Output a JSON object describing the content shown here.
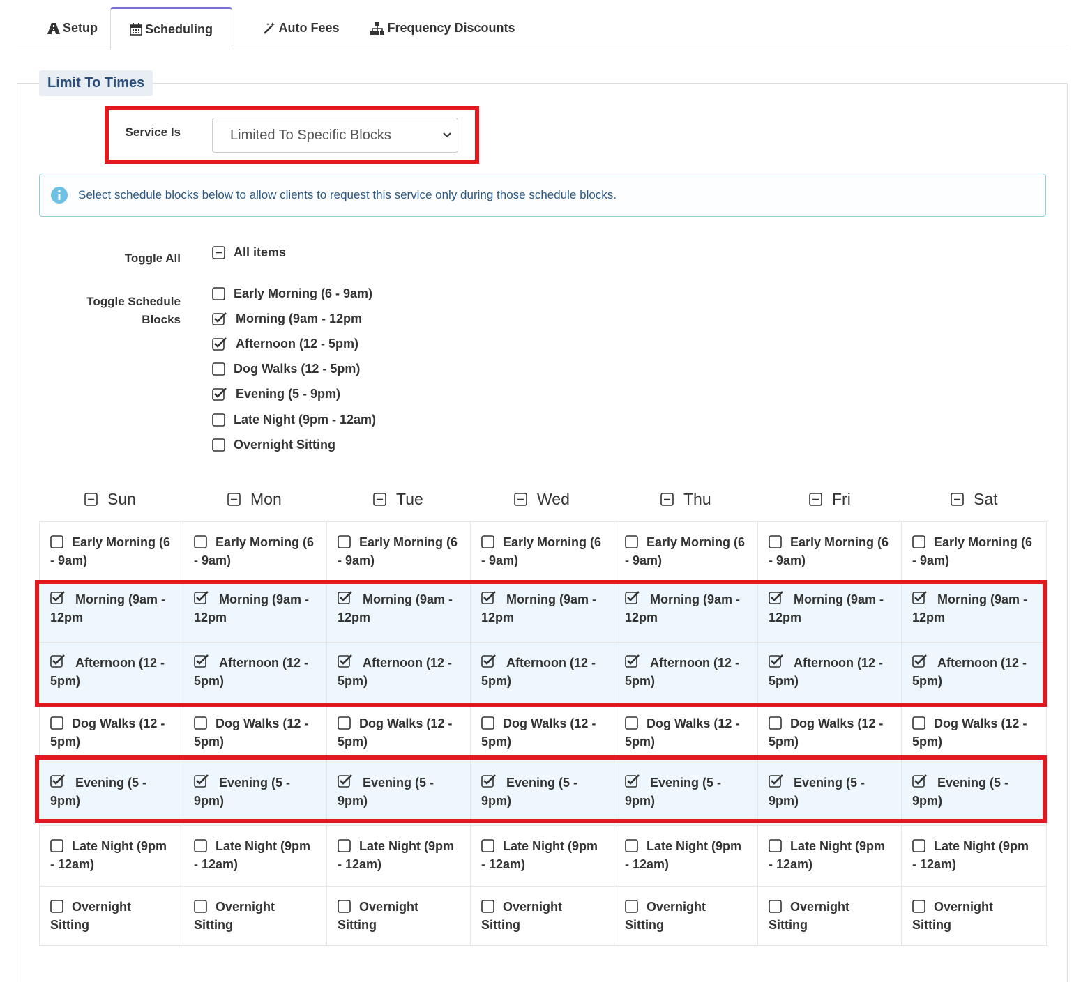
{
  "tabs": [
    {
      "label": "Setup",
      "icon": "road-icon"
    },
    {
      "label": "Scheduling",
      "icon": "calendar-icon",
      "active": true
    },
    {
      "label": "Auto Fees",
      "icon": "magic-wand-icon"
    },
    {
      "label": "Frequency Discounts",
      "icon": "sitemap-icon"
    }
  ],
  "section": {
    "title": "Limit To Times"
  },
  "service": {
    "label": "Service Is",
    "selected": "Limited To Specific Blocks"
  },
  "info": {
    "text": "Select schedule blocks below to allow clients to request this service only during those schedule blocks."
  },
  "toggle_all": {
    "label": "Toggle All",
    "option": "All items",
    "state": "partial"
  },
  "toggle_blocks": {
    "label_line1": "Toggle Schedule",
    "label_line2": "Blocks",
    "items": [
      {
        "label": "Early Morning (6 - 9am)",
        "checked": false
      },
      {
        "label": "Morning (9am - 12pm",
        "checked": true
      },
      {
        "label": "Afternoon (12 - 5pm)",
        "checked": true
      },
      {
        "label": "Dog Walks (12 - 5pm)",
        "checked": false
      },
      {
        "label": "Evening (5 - 9pm)",
        "checked": true
      },
      {
        "label": "Late Night (9pm - 12am)",
        "checked": false
      },
      {
        "label": "Overnight Sitting",
        "checked": false
      }
    ]
  },
  "days": [
    {
      "label": "Sun",
      "state": "partial"
    },
    {
      "label": "Mon",
      "state": "partial"
    },
    {
      "label": "Tue",
      "state": "partial"
    },
    {
      "label": "Wed",
      "state": "partial"
    },
    {
      "label": "Thu",
      "state": "partial"
    },
    {
      "label": "Fri",
      "state": "partial"
    },
    {
      "label": "Sat",
      "state": "partial"
    }
  ],
  "grid_blocks": [
    {
      "line1": "Early Morning (6",
      "line2": "- 9am)",
      "checked": false
    },
    {
      "line1": "Morning (9am -",
      "line2": "12pm",
      "checked": true
    },
    {
      "line1": "Afternoon (12 -",
      "line2": "5pm)",
      "checked": true
    },
    {
      "line1": "Dog Walks (12 -",
      "line2": "5pm)",
      "checked": false
    },
    {
      "line1": "Evening (5 -",
      "line2": "9pm)",
      "checked": true
    },
    {
      "line1": "Late Night (9pm",
      "line2": "- 12am)",
      "checked": false
    },
    {
      "line1": "Overnight",
      "line2": "Sitting",
      "checked": false
    }
  ],
  "colors": {
    "accent_tab": "#7a6fd6",
    "highlight_box": "#e2191f",
    "checked_row_bg": "#eef7fd",
    "info_border": "#8ad0d8",
    "legend_bg": "#e8eef4"
  }
}
